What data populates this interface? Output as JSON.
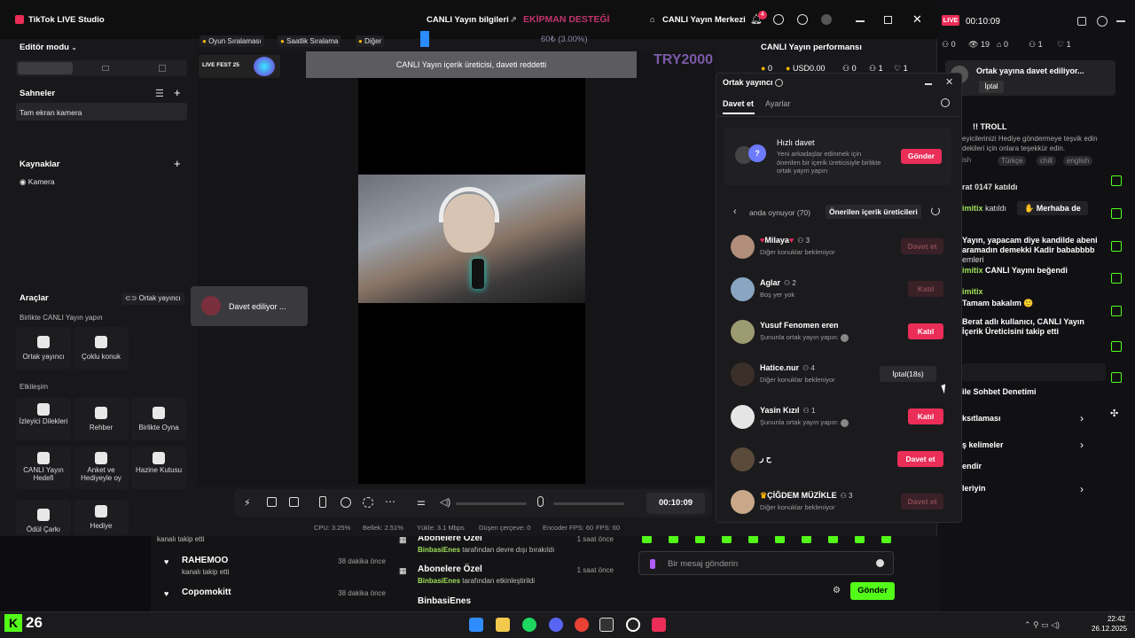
{
  "titlebar": {
    "app_title": "TikTok LIVE Studio",
    "live_info": "CANLI Yayın bilgileri",
    "equipment": "EKİPMAN DESTEĞİ",
    "live_center": "CANLI Yayın Merkezi",
    "notif_count": "4",
    "live_badge": "LIVE",
    "timer": "00:10:09"
  },
  "stats": {
    "row1": [
      "0",
      "19",
      "0",
      "1",
      "1"
    ],
    "perf_title": "CANLI Yayın performansı",
    "perf_values": [
      "0",
      "USD0.00",
      "0",
      "1",
      "1"
    ]
  },
  "sidebar": {
    "mode_label": "Editör modu",
    "scenes_title": "Sahneler",
    "scene_item": "Tam ekran kamera",
    "sources_title": "Kaynaklar",
    "source_item": "Kamera",
    "tools_title": "Araçlar",
    "tools_cohost_link": "Ortak yayıncı",
    "together_title": "Birlikte CANLI Yayın yapın",
    "together_tools": [
      "Ortak yayıncı",
      "Çoklu konuk"
    ],
    "engage_title": "Etkileşim",
    "engage_tools": [
      "İzleyici Dilekleri",
      "Rehber",
      "Birlikte Oyna",
      "CANLI Yayın Hedefi",
      "Anket ve Hediyeyle oy",
      "Hazine Kutusu",
      "Ödül Çarkı",
      "Hediye"
    ]
  },
  "preview": {
    "tabs": [
      "Oyun Sıralaması",
      "Saatlik Sıralama",
      "Diğer"
    ],
    "progress_text": "60₺ (3.00%)",
    "fest_label": "LIVE FEST 25",
    "try_text": "TRY2000",
    "banner_text": "CANLI Yayın içerik üreticisi, daveti reddetti",
    "inviting_text": "Davet ediliyor ...",
    "control_time": "00:10:09",
    "status_items": [
      "CPU: 3.25%",
      "Bellek: 2.51%",
      "Yükle: 3.1 Mbps",
      "Düşen çerçeve: 0",
      "Encoder FPS: 60",
      "FPS: 60"
    ]
  },
  "cohost": {
    "title": "Ortak yayıncı",
    "tabs": [
      "Davet et",
      "Ayarlar"
    ],
    "quick_title": "Hızlı davet",
    "quick_desc": "Yeni arkadaşlar edinmek için önerilen bir içerik üreticisiyle birlikte ortak yayın yapın",
    "quick_button": "Gönder",
    "list_tab_left": "anda oynuyor (70)",
    "list_tab_right": "Önerilen içerik üreticileri",
    "rows": [
      {
        "name": "Milaya",
        "count": "3",
        "status": "Diğer konuklar bekleniyor",
        "button": "Davet et",
        "btn_style": "dim"
      },
      {
        "name": "Aglar",
        "count": "2",
        "status": "Boş yer yok",
        "button": "Katıl",
        "btn_style": "dim"
      },
      {
        "name": "Yusuf Fenomen eren",
        "count": "",
        "status": "Şununla ortak yayın yapın:",
        "button": "Katıl",
        "btn_style": "red"
      },
      {
        "name": "Hatice.nur",
        "count": "4",
        "status": "Diğer konuklar bekleniyor",
        "button": "İptal(18s)",
        "btn_style": "grey"
      },
      {
        "name": "Yasin Kızıl",
        "count": "1",
        "status": "Şununla ortak yayın yapın:",
        "button": "Katıl",
        "btn_style": "red"
      },
      {
        "name": "ح ر",
        "count": "",
        "status": "",
        "button": "Davet et",
        "btn_style": "red"
      },
      {
        "name": "ÇİĞDEM MÜZİKLE",
        "count": "3",
        "status": "Diğer konuklar bekleniyor",
        "button": "Davet et",
        "btn_style": "dim"
      }
    ]
  },
  "right_panel": {
    "waiting_text": "Ortak yayına davet ediliyor...",
    "cancel": "İptal",
    "troll": "!! TROLL",
    "desc1": "eyicilerinizi Hediye göndermeye teşvik edin",
    "desc2": "dekileri için onlara teşekkür edin.",
    "tags": [
      "ish",
      "Türkçe",
      "chill",
      "english"
    ],
    "chat1": "rat 0147 katıldı",
    "chat2_name": "imitix",
    "chat2_text": "katıldı",
    "hello_btn": "Merhaba de",
    "chat3": "Yayın, yapacam diye kandilde abeni aramadın demekki Kadir bababbbb",
    "chat3b": "emleri",
    "chat4_name": "imitix",
    "chat4_text": "CANLI Yayını beğendi",
    "chat5_name": "imitix",
    "chat5_text": "Tamam bakalım 🙂",
    "chat6": "Berat adlı kullanıcı, CANLI Yayın İçerik Üreticisini takip etti",
    "menu": [
      "ile Sohbet Denetimi",
      "ksıtlaması",
      "ş kelimeler",
      "endir",
      "leriyin"
    ]
  },
  "bottom_feed": {
    "left": [
      {
        "name": "",
        "text": "kanalı takip etti",
        "time": ""
      },
      {
        "name": "RAHEMOO",
        "text": "kanalı takip etti",
        "time": "38 dakika önce"
      },
      {
        "name": "Copomokitt",
        "text": "",
        "time": "38 dakika önce"
      }
    ],
    "middle": [
      {
        "title": "Abonelere Özel",
        "user": "BinbasiEnes",
        "text": "tarafından devre dışı bırakıldı",
        "time": "1 saat önce"
      },
      {
        "title": "Abonelere Özel",
        "user": "BinbasiEnes",
        "text": "tarafından etkinleştirildi",
        "time": "1 saat önce"
      },
      {
        "title": "BinbasiEnes",
        "user": "",
        "text": "",
        "time": ""
      }
    ],
    "message_placeholder": "Bir mesaj gönderin",
    "send_button": "Gönder"
  },
  "taskbar": {
    "kick_count": "26",
    "time": "22:42",
    "date": "26.12.2025"
  },
  "colors": {
    "accent": "#ea2e57",
    "kick_green": "#53fc18",
    "chat_green": "#9fe05a"
  }
}
